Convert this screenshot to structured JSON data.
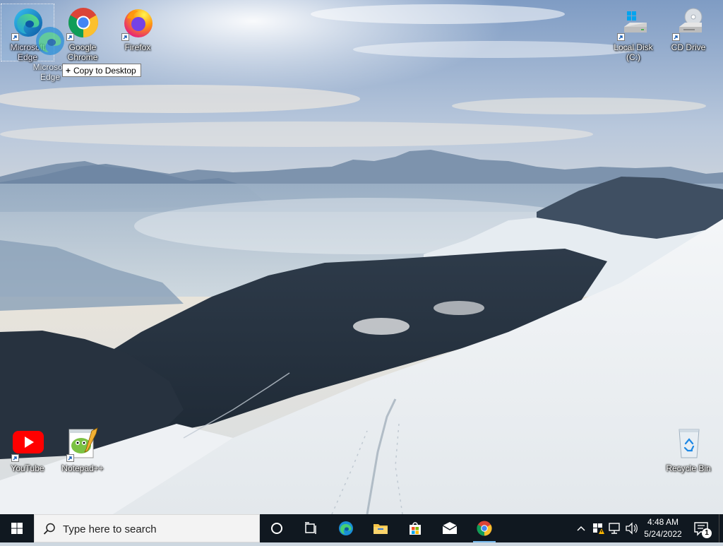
{
  "desktop": {
    "icons": {
      "edge": {
        "label": "Microsoft Edge",
        "icon": "edge-icon"
      },
      "chrome": {
        "label": "Google Chrome",
        "icon": "chrome-icon"
      },
      "firefox": {
        "label": "Firefox",
        "icon": "firefox-icon"
      },
      "local_disk": {
        "label": "Local Disk (C:)",
        "icon": "hard-drive-icon"
      },
      "cd_drive": {
        "label": "CD Drive",
        "icon": "cd-drive-icon"
      },
      "youtube": {
        "label": "YouTube",
        "icon": "youtube-icon"
      },
      "notepadpp": {
        "label": "Notepad++",
        "icon": "notepadpp-icon"
      },
      "recycle_bin": {
        "label": "Recycle Bin",
        "icon": "recycle-bin-icon"
      }
    },
    "drag": {
      "ghost_label": "Microsoft Edge",
      "tooltip": "Copy to Desktop",
      "tooltip_icon": "plus-icon"
    }
  },
  "taskbar": {
    "search_placeholder": "Type here to search",
    "pinned": [
      "cortana-icon",
      "task-view-icon",
      "edge-icon",
      "file-explorer-icon",
      "store-icon",
      "mail-icon",
      "chrome-icon"
    ],
    "tray": {
      "time": "4:48 AM",
      "date": "5/24/2022",
      "notification_count": "1"
    }
  },
  "colors": {
    "taskbar_bg": "#101820",
    "accent": "#76b9ed",
    "search_bg": "#f3f3f3"
  }
}
